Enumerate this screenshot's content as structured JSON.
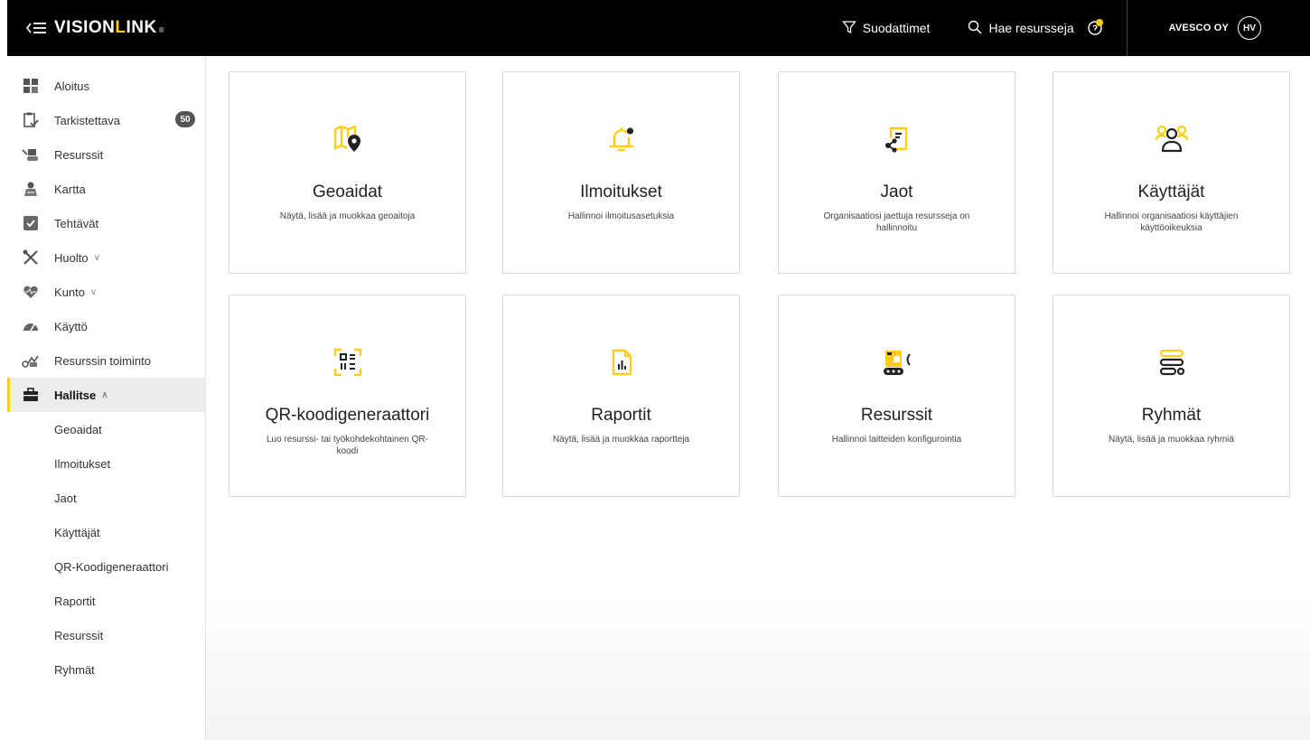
{
  "header": {
    "logo_main": "VISION",
    "logo_l": "L",
    "logo_rest": "INK",
    "logo_mark": "®",
    "filters_label": "Suodattimet",
    "search_label": "Hae resursseja",
    "org_name": "AVESCO OY",
    "avatar_initials": "HV"
  },
  "sidebar": {
    "items": [
      {
        "label": "Aloitus",
        "icon": "grid-icon"
      },
      {
        "label": "Tarkistettava",
        "icon": "clipboard-check-icon",
        "badge": "50"
      },
      {
        "label": "Resurssit",
        "icon": "machine-icon"
      },
      {
        "label": "Kartta",
        "icon": "map-icon"
      },
      {
        "label": "Tehtävät",
        "icon": "tasks-icon"
      },
      {
        "label": "Huolto",
        "icon": "tools-icon",
        "chevron": "∨"
      },
      {
        "label": "Kunto",
        "icon": "heart-icon",
        "chevron": "∨"
      },
      {
        "label": "Käyttö",
        "icon": "gauge-icon"
      },
      {
        "label": "Resurssin toiminto",
        "icon": "activity-icon"
      },
      {
        "label": "Hallitse",
        "icon": "briefcase-icon",
        "chevron": "∧"
      }
    ],
    "sub_items": [
      "Geoaidat",
      "Ilmoitukset",
      "Jaot",
      "Käyttäjät",
      "QR-Koodigeneraattori",
      "Raportit",
      "Resurssit",
      "Ryhmät"
    ]
  },
  "cards": [
    {
      "title": "Geoaidat",
      "desc": "Näytä, lisää ja muokkaa geoaitoja",
      "icon": "map-pin-icon"
    },
    {
      "title": "Ilmoitukset",
      "desc": "Hallinnoi ilmoitusasetuksia",
      "icon": "bell-icon"
    },
    {
      "title": "Jaot",
      "desc": "Organisaatiosi jaettuja resursseja on hallinnoitu",
      "icon": "share-document-icon"
    },
    {
      "title": "Käyttäjät",
      "desc": "Hallinnoi organisaatiosi käyttäjien käyttöoikeuksia",
      "icon": "users-icon"
    },
    {
      "title": "QR-koodigeneraattori",
      "desc": "Luo resurssi- tai työkohdekohtainen QR-koodi",
      "icon": "qr-code-icon"
    },
    {
      "title": "Raportit",
      "desc": "Näytä, lisää ja muokkaa raportteja",
      "icon": "report-icon"
    },
    {
      "title": "Resurssit",
      "desc": "Hallinnoi laitteiden konfigurointia",
      "icon": "device-config-icon"
    },
    {
      "title": "Ryhmät",
      "desc": "Näytä, lisää ja muokkaa ryhmiä",
      "icon": "groups-icon"
    }
  ],
  "colors": {
    "accent": "#ffcd11",
    "topbar": "#000000",
    "active_bg": "#ececec",
    "badge": "#555555"
  }
}
